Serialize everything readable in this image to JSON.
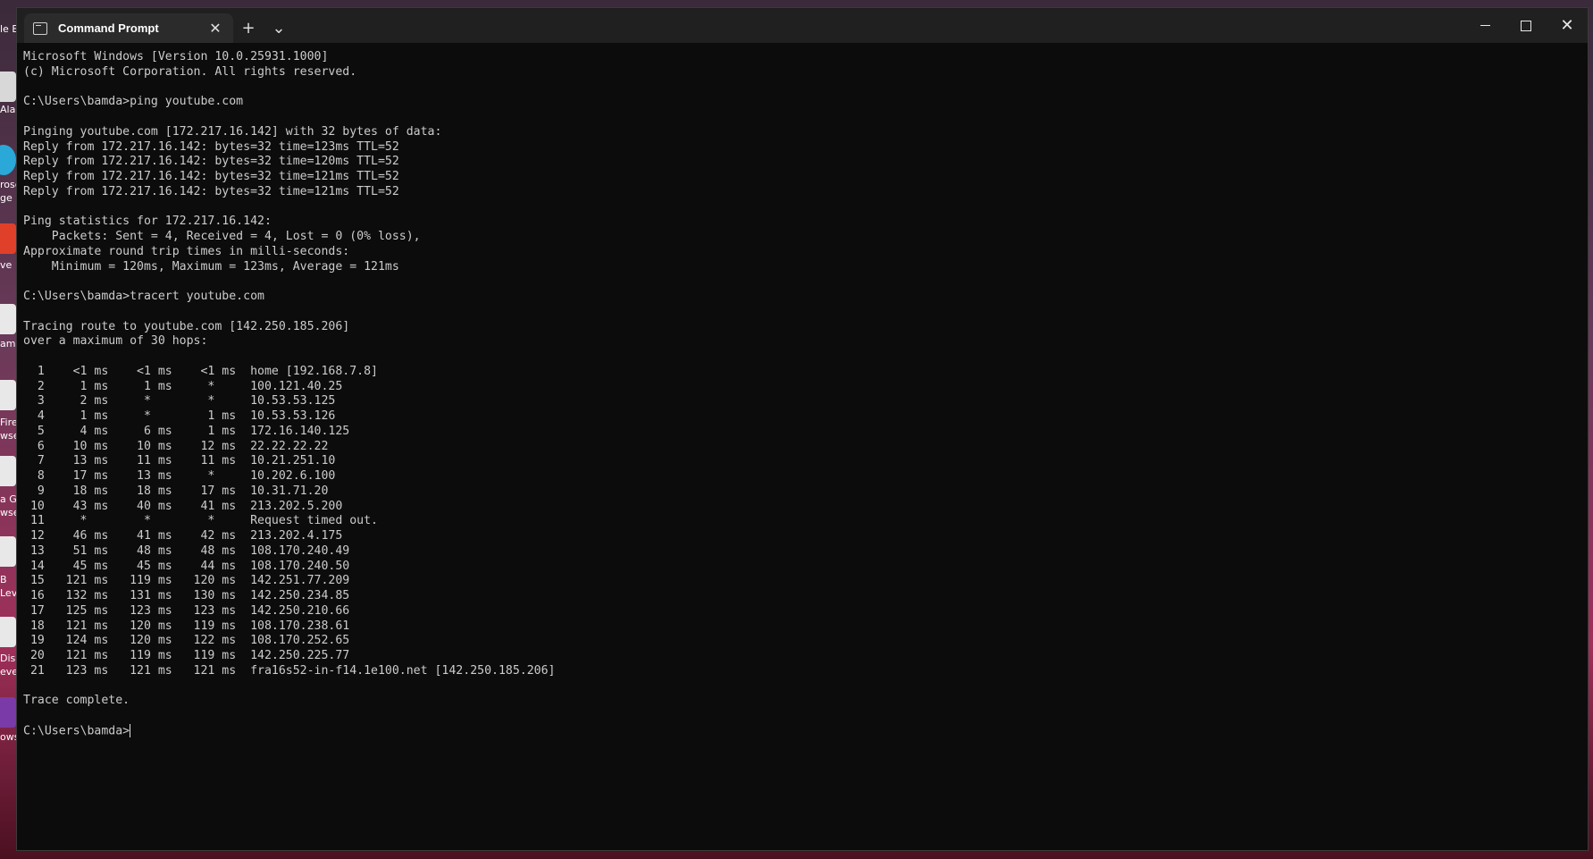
{
  "window": {
    "tab_title": "Command Prompt",
    "new_tab_symbol": "+",
    "dropdown_symbol": "⌄",
    "close_symbol": "✕"
  },
  "desktop": {
    "labels": [
      "le B",
      "Alar",
      "rosof",
      "ge",
      "ve",
      "am",
      "Fire",
      "wse",
      "a G",
      "wse",
      "B",
      "Lev",
      "Dis",
      "evel",
      "ows"
    ]
  },
  "console": {
    "lines": [
      "Microsoft Windows [Version 10.0.25931.1000]",
      "(c) Microsoft Corporation. All rights reserved.",
      "",
      "C:\\Users\\bamda>ping youtube.com",
      "",
      "Pinging youtube.com [172.217.16.142] with 32 bytes of data:",
      "Reply from 172.217.16.142: bytes=32 time=123ms TTL=52",
      "Reply from 172.217.16.142: bytes=32 time=120ms TTL=52",
      "Reply from 172.217.16.142: bytes=32 time=121ms TTL=52",
      "Reply from 172.217.16.142: bytes=32 time=121ms TTL=52",
      "",
      "Ping statistics for 172.217.16.142:",
      "    Packets: Sent = 4, Received = 4, Lost = 0 (0% loss),",
      "Approximate round trip times in milli-seconds:",
      "    Minimum = 120ms, Maximum = 123ms, Average = 121ms",
      "",
      "C:\\Users\\bamda>tracert youtube.com",
      "",
      "Tracing route to youtube.com [142.250.185.206]",
      "over a maximum of 30 hops:",
      "",
      "  1    <1 ms    <1 ms    <1 ms  home [192.168.7.8]",
      "  2     1 ms     1 ms     *     100.121.40.25",
      "  3     2 ms     *        *     10.53.53.125",
      "  4     1 ms     *        1 ms  10.53.53.126",
      "  5     4 ms     6 ms     1 ms  172.16.140.125",
      "  6    10 ms    10 ms    12 ms  22.22.22.22",
      "  7    13 ms    11 ms    11 ms  10.21.251.10",
      "  8    17 ms    13 ms     *     10.202.6.100",
      "  9    18 ms    18 ms    17 ms  10.31.71.20",
      " 10    43 ms    40 ms    41 ms  213.202.5.200",
      " 11     *        *        *     Request timed out.",
      " 12    46 ms    41 ms    42 ms  213.202.4.175",
      " 13    51 ms    48 ms    48 ms  108.170.240.49",
      " 14    45 ms    45 ms    44 ms  108.170.240.50",
      " 15   121 ms   119 ms   120 ms  142.251.77.209",
      " 16   132 ms   131 ms   130 ms  142.250.234.85",
      " 17   125 ms   123 ms   123 ms  142.250.210.66",
      " 18   121 ms   120 ms   119 ms  108.170.238.61",
      " 19   124 ms   120 ms   122 ms  108.170.252.65",
      " 20   121 ms   119 ms   119 ms  142.250.225.77",
      " 21   123 ms   121 ms   121 ms  fra16s52-in-f14.1e100.net [142.250.185.206]",
      "",
      "Trace complete.",
      "",
      "C:\\Users\\bamda>"
    ]
  }
}
